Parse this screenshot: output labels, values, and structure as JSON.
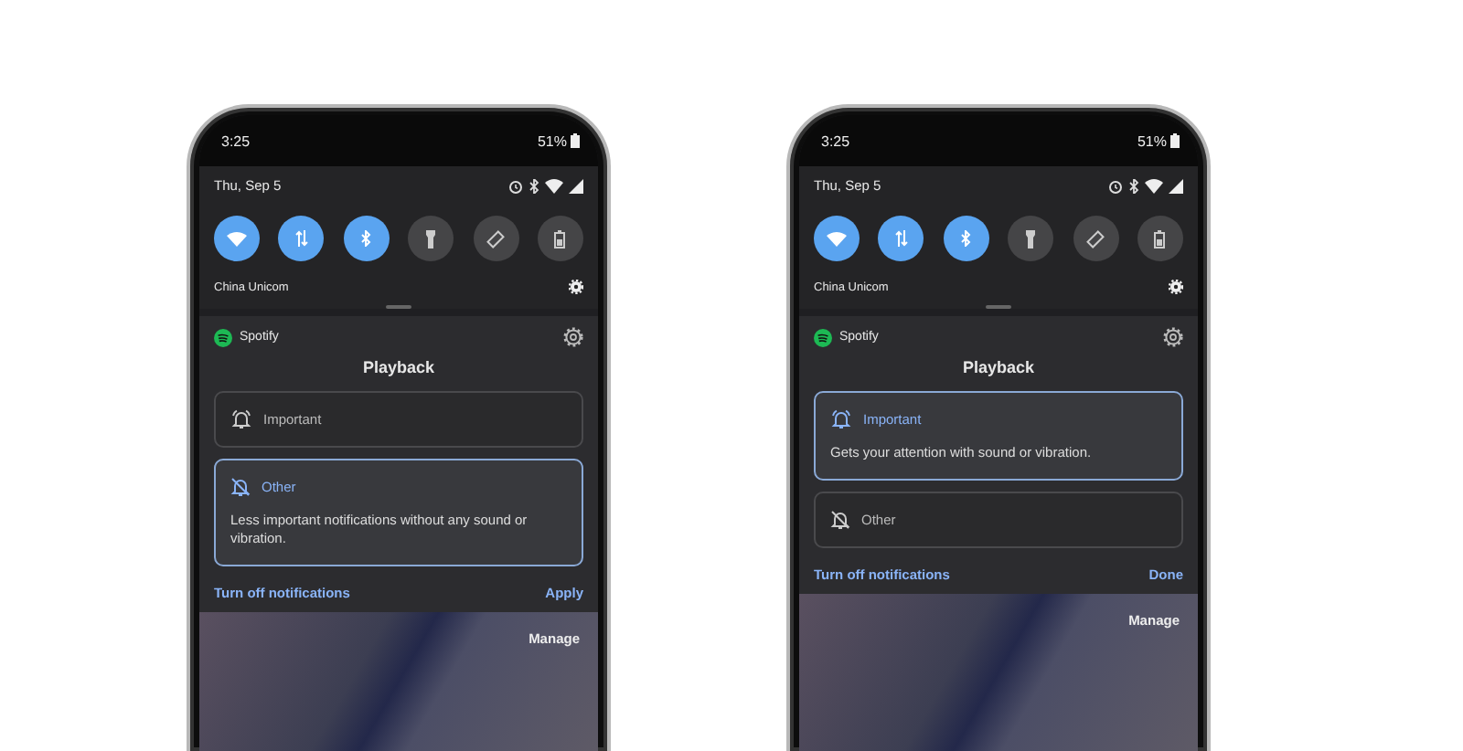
{
  "phones": [
    {
      "status_bar": {
        "time": "3:25",
        "battery": "51%"
      },
      "quick_settings": {
        "date": "Thu, Sep 5",
        "tiles": [
          {
            "kind": "wifi",
            "on": true
          },
          {
            "kind": "data",
            "on": true
          },
          {
            "kind": "bluetooth",
            "on": true
          },
          {
            "kind": "flashlight",
            "on": false
          },
          {
            "kind": "rotate",
            "on": false
          },
          {
            "kind": "battery",
            "on": false
          }
        ],
        "carrier": "China Unicom"
      },
      "notification": {
        "app": "Spotify",
        "channel": "Playback",
        "options": [
          {
            "kind": "alert",
            "label": "Important",
            "selected": false
          },
          {
            "kind": "silent",
            "label": "Other",
            "description": "Less important notifications without any sound or vibration.",
            "selected": true
          }
        ],
        "turn_off": "Turn off notifications",
        "action": "Apply"
      },
      "manage": "Manage"
    },
    {
      "status_bar": {
        "time": "3:25",
        "battery": "51%"
      },
      "quick_settings": {
        "date": "Thu, Sep 5",
        "tiles": [
          {
            "kind": "wifi",
            "on": true
          },
          {
            "kind": "data",
            "on": true
          },
          {
            "kind": "bluetooth",
            "on": true
          },
          {
            "kind": "flashlight",
            "on": false
          },
          {
            "kind": "rotate",
            "on": false
          },
          {
            "kind": "battery",
            "on": false
          }
        ],
        "carrier": "China Unicom"
      },
      "notification": {
        "app": "Spotify",
        "channel": "Playback",
        "options": [
          {
            "kind": "alert",
            "label": "Important",
            "description": "Gets your attention with sound or vibration.",
            "selected": true
          },
          {
            "kind": "silent",
            "label": "Other",
            "selected": false
          }
        ],
        "turn_off": "Turn off notifications",
        "action": "Done"
      },
      "manage": "Manage"
    }
  ]
}
